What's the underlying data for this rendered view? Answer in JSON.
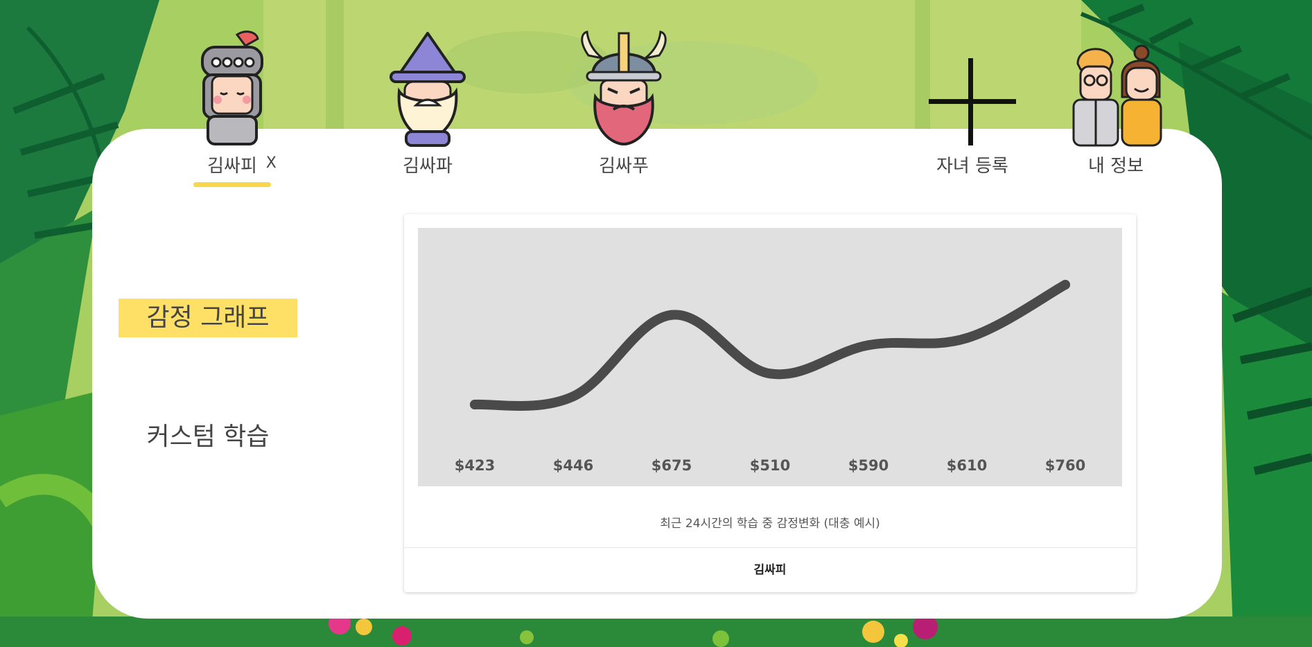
{
  "children": [
    {
      "name": "김싸피",
      "avatar": "knight-icon",
      "selected": true,
      "close": "X"
    },
    {
      "name": "김싸파",
      "avatar": "wizard-icon",
      "selected": false
    },
    {
      "name": "김싸푸",
      "avatar": "viking-icon",
      "selected": false
    }
  ],
  "actions": {
    "add_child_label": "자녀 등록",
    "add_child_icon": "plus-icon",
    "my_info_label": "내 정보",
    "my_info_icon": "parents-icon"
  },
  "menu": {
    "items": [
      {
        "label": "감정 그래프",
        "active": true
      },
      {
        "label": "커스텀 학습",
        "active": false
      }
    ]
  },
  "chart_data": {
    "type": "line",
    "categories": [
      "$423",
      "$446",
      "$675",
      "$510",
      "$590",
      "$610",
      "$760"
    ],
    "values": [
      423,
      446,
      675,
      510,
      590,
      610,
      760
    ],
    "title": "",
    "caption": "최근 24시간의 학습 중 감정변화 (대충 예시)",
    "footer": "김싸피",
    "grid": false,
    "line_color": "#4a4a4a",
    "background": "#e0e0e0"
  },
  "colors": {
    "accent": "#ffe066",
    "underline": "#f7d84c"
  }
}
